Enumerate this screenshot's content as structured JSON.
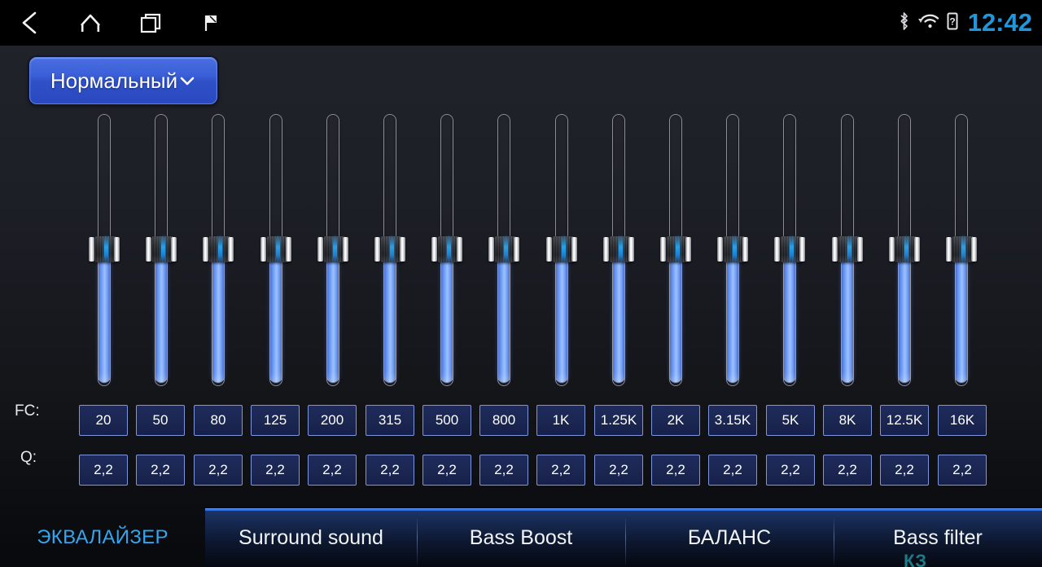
{
  "statusbar": {
    "nav": [
      {
        "name": "back-icon",
        "label": "Back"
      },
      {
        "name": "home-icon",
        "label": "Home"
      },
      {
        "name": "recents-icon",
        "label": "Recent apps"
      },
      {
        "name": "flag-icon",
        "label": "Flag"
      }
    ],
    "icons": [
      {
        "name": "bluetooth-icon",
        "label": "Bluetooth"
      },
      {
        "name": "wifi-icon",
        "label": "Wi-Fi"
      },
      {
        "name": "sim-unknown-icon",
        "label": "?"
      }
    ],
    "time": "12:42"
  },
  "preset": {
    "label": "Нормальный",
    "chevron": "chevron-down-icon"
  },
  "equalizer": {
    "fc_label": "FC:",
    "q_label": "Q:",
    "bands": [
      {
        "fc": "20",
        "q": "2,2",
        "value": 50
      },
      {
        "fc": "50",
        "q": "2,2",
        "value": 50
      },
      {
        "fc": "80",
        "q": "2,2",
        "value": 50
      },
      {
        "fc": "125",
        "q": "2,2",
        "value": 50
      },
      {
        "fc": "200",
        "q": "2,2",
        "value": 50
      },
      {
        "fc": "315",
        "q": "2,2",
        "value": 50
      },
      {
        "fc": "500",
        "q": "2,2",
        "value": 50
      },
      {
        "fc": "800",
        "q": "2,2",
        "value": 50
      },
      {
        "fc": "1K",
        "q": "2,2",
        "value": 50
      },
      {
        "fc": "1.25K",
        "q": "2,2",
        "value": 50
      },
      {
        "fc": "2K",
        "q": "2,2",
        "value": 50
      },
      {
        "fc": "3.15K",
        "q": "2,2",
        "value": 50
      },
      {
        "fc": "5K",
        "q": "2,2",
        "value": 50
      },
      {
        "fc": "8K",
        "q": "2,2",
        "value": 50
      },
      {
        "fc": "12.5K",
        "q": "2,2",
        "value": 50
      },
      {
        "fc": "16K",
        "q": "2,2",
        "value": 50
      }
    ]
  },
  "tabs": [
    {
      "label": "ЭКВАЛАЙЗЕР",
      "active": true
    },
    {
      "label": "Surround sound",
      "active": false
    },
    {
      "label": "Bass Boost",
      "active": false
    },
    {
      "label": "БАЛАНС",
      "active": false
    },
    {
      "label": "Bass filter",
      "active": false
    }
  ],
  "watermark": "КЗ",
  "colors": {
    "accent_blue": "#34a5ef",
    "slider_blue": "#89b3fb",
    "preset_blue": "#3a5fd8",
    "button_border": "#7e96dc",
    "background": "#1d1f27"
  }
}
